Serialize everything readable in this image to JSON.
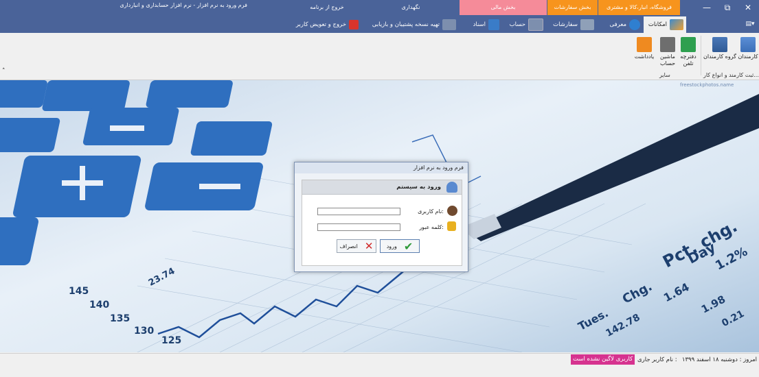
{
  "window": {
    "title": "فرم ورود به نرم افزار - نرم افزار حسابداری و انبارداری",
    "controls": {
      "close": "✕",
      "restore": "⧉",
      "minimize": "—",
      "menu": "▤▾"
    }
  },
  "categories": [
    {
      "label": "فروشگاه، انبار،کالا و مشتری",
      "color": "#f7941d"
    },
    {
      "label": "بخش سفارشات",
      "color": "#f7941d"
    },
    {
      "label": "بخش مالی",
      "color": "#f58b99"
    },
    {
      "label": "نگهداری",
      "color": "#4a6399"
    },
    {
      "label": "خروج از برنامه",
      "color": "#4a6399"
    }
  ],
  "tabs": {
    "emkanat": "امکانات",
    "moarefi": "معرفی",
    "sefareshat": "سفارشات",
    "hesab": "حساب",
    "asnad": "اسناد",
    "backup": "تهیه نسخه پشتیبان و بازیابی",
    "exit_user": "خروج و تعویض کاربر"
  },
  "ribbon": {
    "btn_karmandan": "کارمندان",
    "btn_goroh": "گروه کارمندان",
    "btn_daftarche_1": "دفترچه",
    "btn_daftarche_2": "تلفن",
    "btn_mashin_1": "ماشین",
    "btn_mashin_2": "حساب",
    "btn_yaddasht": "یادداشت",
    "group_employees": "ثبت کارمند و انواع کار...",
    "group_other": "سایر",
    "collapse": "˄"
  },
  "background": {
    "watermark": "freestockphotos.name",
    "pct_chg": "Pct. chg.",
    "day": "Day",
    "chg": "Chg.",
    "tues": "Tues.",
    "v1_2": "1.2%",
    "v1_64": "1.64",
    "v1_98": "1.98",
    "v23_74": "23.74",
    "v142_78": "142.78",
    "v0_21": "0.21",
    "ticks": [
      "145",
      "140",
      "135",
      "130",
      "125"
    ]
  },
  "login": {
    "dialog_title": "فرم ورود به نرم افزار",
    "header": "ورود به سیستم",
    "username_label": "نام کاربری:",
    "password_label": "کلمه عبور:",
    "username_value": "",
    "password_value": "",
    "login_button": "ورود",
    "cancel_button": "انصراف"
  },
  "status": {
    "today": "امروز : دوشنبه ۱۸ اسفند ۱۳۹۹",
    "current_user_label": "نام کاربر جاری :",
    "current_user_value": "کاربری لاگین نشده است"
  },
  "colors": {
    "titlebar": "#4a6399",
    "orange_tab": "#f7941d",
    "pink_tab": "#f58b99",
    "badge": "#d6338f"
  }
}
